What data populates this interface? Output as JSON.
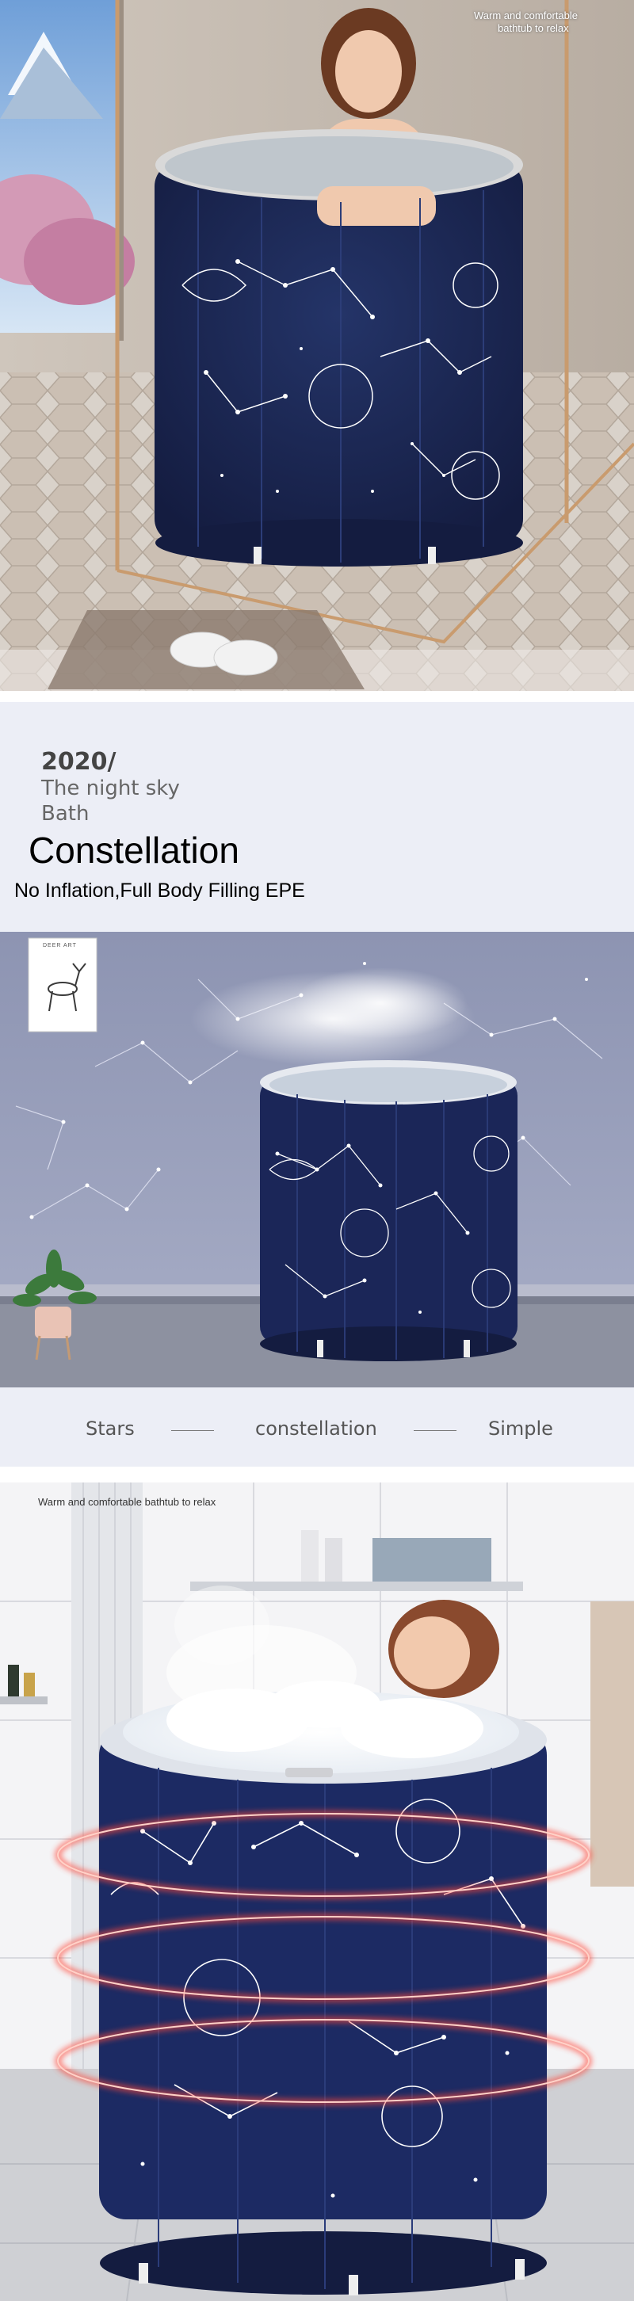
{
  "hero": {
    "tagline_line1": "Warm and comfortable",
    "tagline_line2": "bathtub to relax"
  },
  "intro": {
    "year": "2020/",
    "subtitle_line1": "The night sky",
    "subtitle_line2": "Bath",
    "title": "Constellation",
    "description": "No Inflation,Full Body Filling EPE"
  },
  "room": {
    "poster_title": "DEER ART"
  },
  "features": {
    "items": [
      "Stars",
      "constellation",
      "Simple"
    ]
  },
  "bathroom": {
    "tagline": "Warm and comfortable bathtub to relax"
  },
  "colors": {
    "navy": "#1d2a5a",
    "light_band": "#eceef6",
    "text_gray": "#555555",
    "heat_ring": "#ff4a3a"
  }
}
